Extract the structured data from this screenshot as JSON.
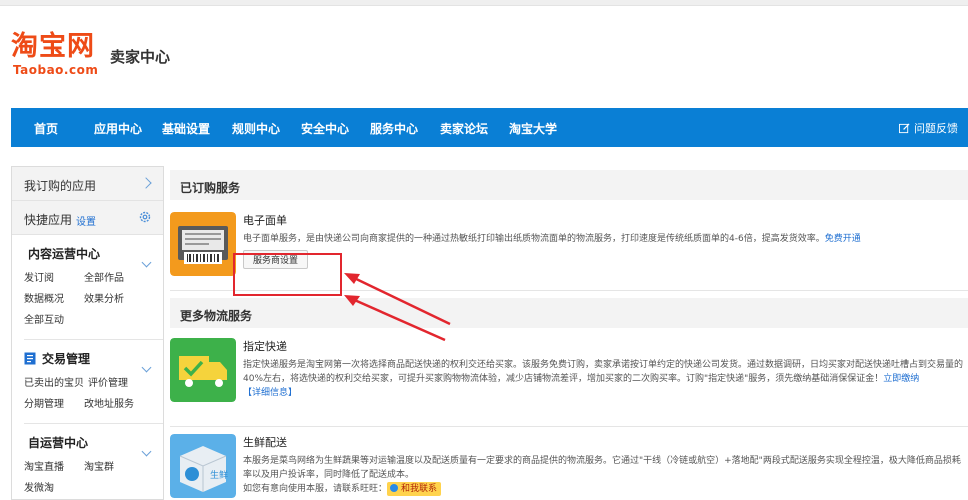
{
  "header": {
    "logo_cn": "淘宝网",
    "logo_en": "Taobao.com",
    "center_title": "卖家中心"
  },
  "nav": {
    "items": [
      "首页",
      "应用中心",
      "基础设置",
      "规则中心",
      "安全中心",
      "服务中心",
      "卖家论坛",
      "淘宝大学"
    ],
    "feedback": "问题反馈"
  },
  "sidebar": {
    "my_apps": "我订购的应用",
    "quick_apps": "快捷应用",
    "quick_settings": "设置",
    "groups": [
      {
        "title": "内容运营中心",
        "links": [
          "发订阅",
          "全部作品",
          "数据概况",
          "效果分析",
          "全部互动"
        ]
      },
      {
        "title": "交易管理",
        "links": [
          "已卖出的宝贝",
          "评价管理",
          "分期管理",
          "改地址服务"
        ]
      },
      {
        "title": "自运营中心",
        "links": [
          "淘宝直播",
          "淘宝群",
          "发微淘"
        ]
      }
    ]
  },
  "main": {
    "subscribed_title": "已订购服务",
    "more_title": "更多物流服务",
    "services": [
      {
        "title": "电子面单",
        "desc": "电子面单服务，是由快递公司向商家提供的一种通过热敏纸打印输出纸质物流面单的物流服务，打印速度是传统纸质面单的4-6倍，提高发货效率。",
        "link": "免费开通",
        "button": "服务商设置"
      }
    ],
    "more_services": [
      {
        "title": "指定快递",
        "desc": "指定快递服务是淘宝网第一次将选择商品配送快递的权利交还给买家。该服务免费订购，卖家承诺按订单约定的快递公司发货。通过数据调研，日均买家对配送快递吐槽占到交易量的40%左右，将选快递的权利交给买家，可提升买家购物物流体验，减少店铺物流差评，增加买家的二次购买率。订购\"指定快递\"服务，须先缴纳基础消保保证金！",
        "link_inline": "立即缴纳",
        "link": "【详细信息】"
      },
      {
        "title": "生鲜配送",
        "desc": "本服务是菜鸟网络为生鲜蔬果等对运输温度以及配送质量有一定要求的商品提供的物流服务。它通过\"干线（冷链或航空）+落地配\"两段式配送服务实现全程控温，极大降低商品损耗率以及用户投诉率，同时降低了配送成本。",
        "contact": "如您有意向使用本服，请联系旺旺：",
        "tag": "和我联系"
      }
    ]
  },
  "colors": {
    "brand_orange": "#ee4b17",
    "nav_blue": "#0a7fd5",
    "annotation_red": "#e2262e",
    "link_blue": "#1f6fd1"
  }
}
